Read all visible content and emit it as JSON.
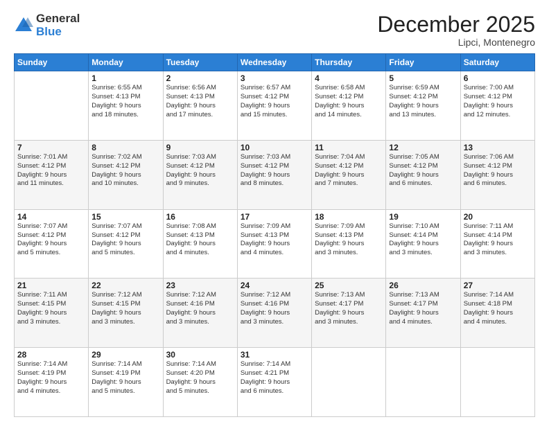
{
  "logo": {
    "general": "General",
    "blue": "Blue"
  },
  "header": {
    "month": "December 2025",
    "location": "Lipci, Montenegro"
  },
  "weekdays": [
    "Sunday",
    "Monday",
    "Tuesday",
    "Wednesday",
    "Thursday",
    "Friday",
    "Saturday"
  ],
  "weeks": [
    [
      {
        "day": "",
        "info": ""
      },
      {
        "day": "1",
        "info": "Sunrise: 6:55 AM\nSunset: 4:13 PM\nDaylight: 9 hours\nand 18 minutes."
      },
      {
        "day": "2",
        "info": "Sunrise: 6:56 AM\nSunset: 4:13 PM\nDaylight: 9 hours\nand 17 minutes."
      },
      {
        "day": "3",
        "info": "Sunrise: 6:57 AM\nSunset: 4:12 PM\nDaylight: 9 hours\nand 15 minutes."
      },
      {
        "day": "4",
        "info": "Sunrise: 6:58 AM\nSunset: 4:12 PM\nDaylight: 9 hours\nand 14 minutes."
      },
      {
        "day": "5",
        "info": "Sunrise: 6:59 AM\nSunset: 4:12 PM\nDaylight: 9 hours\nand 13 minutes."
      },
      {
        "day": "6",
        "info": "Sunrise: 7:00 AM\nSunset: 4:12 PM\nDaylight: 9 hours\nand 12 minutes."
      }
    ],
    [
      {
        "day": "7",
        "info": "Sunrise: 7:01 AM\nSunset: 4:12 PM\nDaylight: 9 hours\nand 11 minutes."
      },
      {
        "day": "8",
        "info": "Sunrise: 7:02 AM\nSunset: 4:12 PM\nDaylight: 9 hours\nand 10 minutes."
      },
      {
        "day": "9",
        "info": "Sunrise: 7:03 AM\nSunset: 4:12 PM\nDaylight: 9 hours\nand 9 minutes."
      },
      {
        "day": "10",
        "info": "Sunrise: 7:03 AM\nSunset: 4:12 PM\nDaylight: 9 hours\nand 8 minutes."
      },
      {
        "day": "11",
        "info": "Sunrise: 7:04 AM\nSunset: 4:12 PM\nDaylight: 9 hours\nand 7 minutes."
      },
      {
        "day": "12",
        "info": "Sunrise: 7:05 AM\nSunset: 4:12 PM\nDaylight: 9 hours\nand 6 minutes."
      },
      {
        "day": "13",
        "info": "Sunrise: 7:06 AM\nSunset: 4:12 PM\nDaylight: 9 hours\nand 6 minutes."
      }
    ],
    [
      {
        "day": "14",
        "info": "Sunrise: 7:07 AM\nSunset: 4:12 PM\nDaylight: 9 hours\nand 5 minutes."
      },
      {
        "day": "15",
        "info": "Sunrise: 7:07 AM\nSunset: 4:12 PM\nDaylight: 9 hours\nand 5 minutes."
      },
      {
        "day": "16",
        "info": "Sunrise: 7:08 AM\nSunset: 4:13 PM\nDaylight: 9 hours\nand 4 minutes."
      },
      {
        "day": "17",
        "info": "Sunrise: 7:09 AM\nSunset: 4:13 PM\nDaylight: 9 hours\nand 4 minutes."
      },
      {
        "day": "18",
        "info": "Sunrise: 7:09 AM\nSunset: 4:13 PM\nDaylight: 9 hours\nand 3 minutes."
      },
      {
        "day": "19",
        "info": "Sunrise: 7:10 AM\nSunset: 4:14 PM\nDaylight: 9 hours\nand 3 minutes."
      },
      {
        "day": "20",
        "info": "Sunrise: 7:11 AM\nSunset: 4:14 PM\nDaylight: 9 hours\nand 3 minutes."
      }
    ],
    [
      {
        "day": "21",
        "info": "Sunrise: 7:11 AM\nSunset: 4:15 PM\nDaylight: 9 hours\nand 3 minutes."
      },
      {
        "day": "22",
        "info": "Sunrise: 7:12 AM\nSunset: 4:15 PM\nDaylight: 9 hours\nand 3 minutes."
      },
      {
        "day": "23",
        "info": "Sunrise: 7:12 AM\nSunset: 4:16 PM\nDaylight: 9 hours\nand 3 minutes."
      },
      {
        "day": "24",
        "info": "Sunrise: 7:12 AM\nSunset: 4:16 PM\nDaylight: 9 hours\nand 3 minutes."
      },
      {
        "day": "25",
        "info": "Sunrise: 7:13 AM\nSunset: 4:17 PM\nDaylight: 9 hours\nand 3 minutes."
      },
      {
        "day": "26",
        "info": "Sunrise: 7:13 AM\nSunset: 4:17 PM\nDaylight: 9 hours\nand 4 minutes."
      },
      {
        "day": "27",
        "info": "Sunrise: 7:14 AM\nSunset: 4:18 PM\nDaylight: 9 hours\nand 4 minutes."
      }
    ],
    [
      {
        "day": "28",
        "info": "Sunrise: 7:14 AM\nSunset: 4:19 PM\nDaylight: 9 hours\nand 4 minutes."
      },
      {
        "day": "29",
        "info": "Sunrise: 7:14 AM\nSunset: 4:19 PM\nDaylight: 9 hours\nand 5 minutes."
      },
      {
        "day": "30",
        "info": "Sunrise: 7:14 AM\nSunset: 4:20 PM\nDaylight: 9 hours\nand 5 minutes."
      },
      {
        "day": "31",
        "info": "Sunrise: 7:14 AM\nSunset: 4:21 PM\nDaylight: 9 hours\nand 6 minutes."
      },
      {
        "day": "",
        "info": ""
      },
      {
        "day": "",
        "info": ""
      },
      {
        "day": "",
        "info": ""
      }
    ]
  ]
}
